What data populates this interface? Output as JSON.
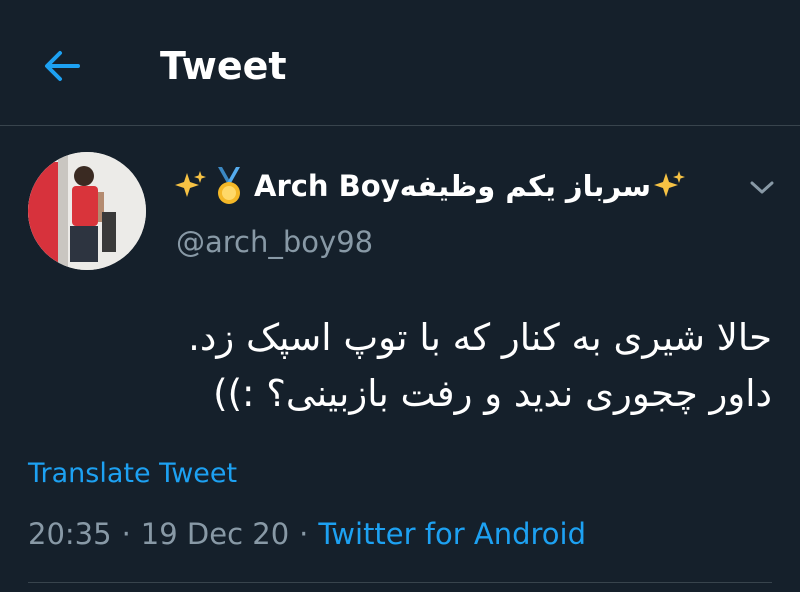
{
  "header": {
    "title": "Tweet",
    "back_icon": "arrow-left-icon"
  },
  "tweet": {
    "author": {
      "name_fa": "سرباز یکم وظیفه",
      "name_en": "Arch Boy",
      "emojis": [
        "sparkles-icon",
        "medal-icon",
        "sparkles-icon"
      ],
      "handle": "@arch_boy98"
    },
    "text_lines": [
      "حالا شیری به کنار که با توپ اسپک زد.",
      "داور چجوری ندید و رفت بازبینی؟ :))"
    ],
    "translate_label": "Translate Tweet",
    "time": "20:35",
    "separator": "·",
    "date": "19 Dec 20",
    "source": "Twitter for Android"
  },
  "colors": {
    "background": "#15202b",
    "accent": "#1da1f2",
    "muted": "#8899a6",
    "divider": "#38444d"
  }
}
